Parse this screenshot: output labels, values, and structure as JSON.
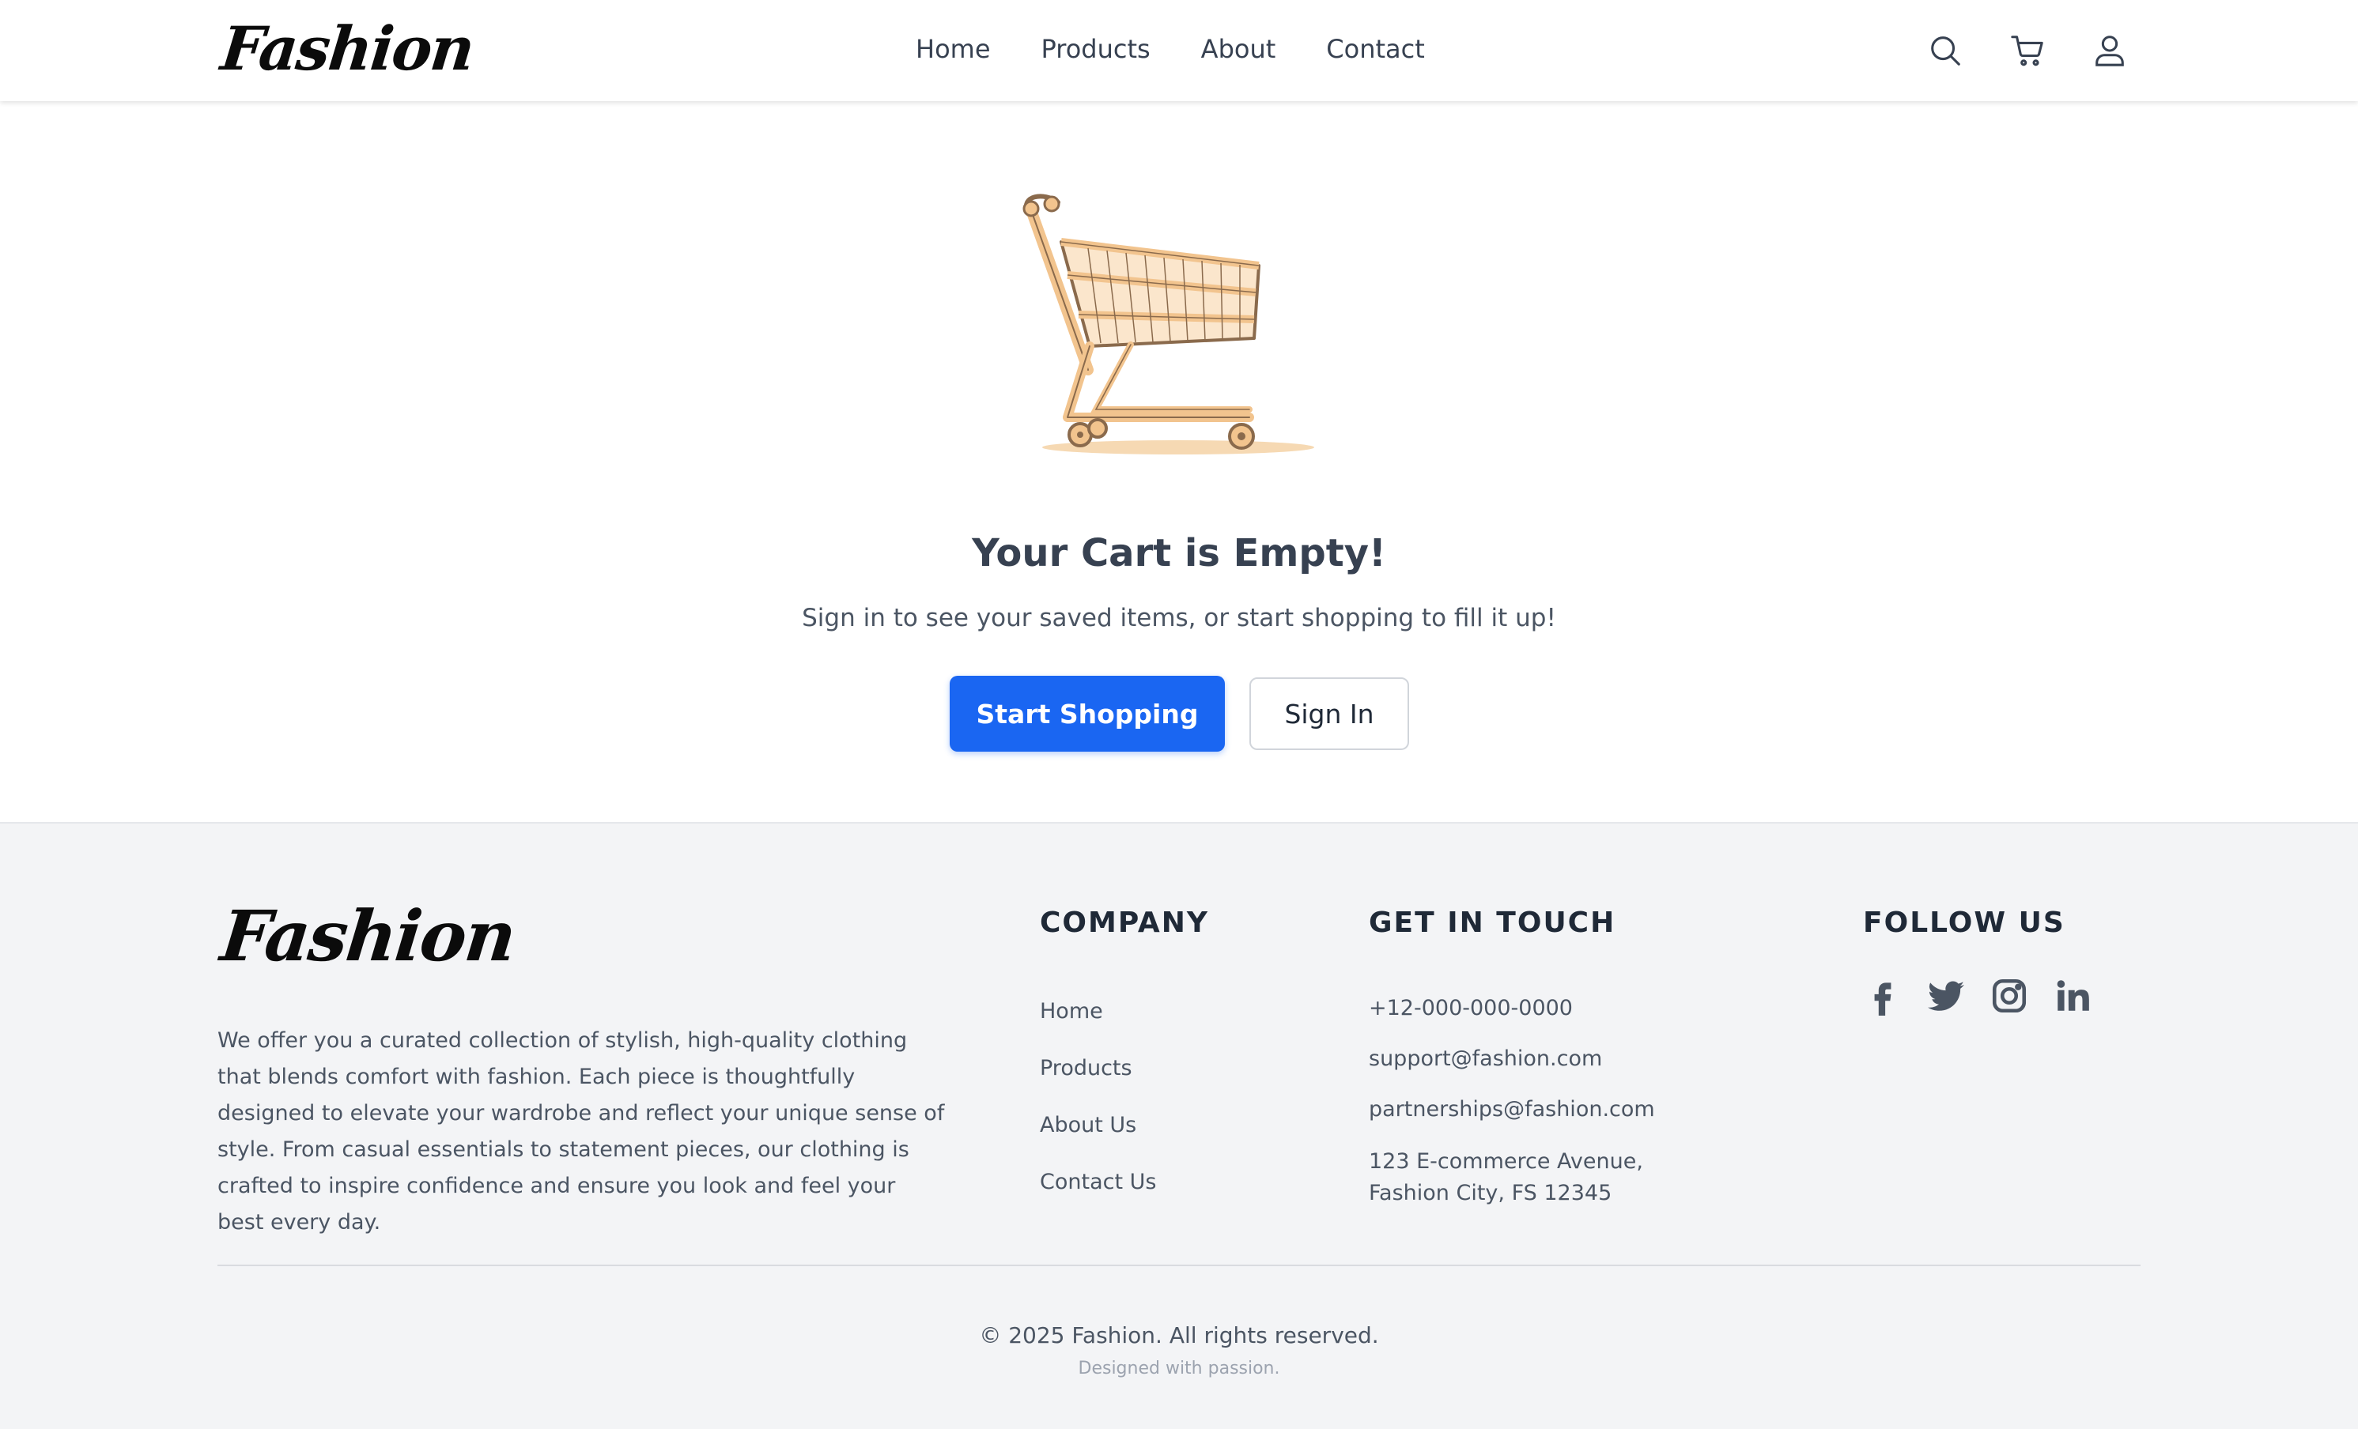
{
  "brand": {
    "name": "Fashion"
  },
  "nav": {
    "items": [
      {
        "label": "Home"
      },
      {
        "label": "Products"
      },
      {
        "label": "About"
      },
      {
        "label": "Contact"
      }
    ]
  },
  "header_icons": [
    "search-icon",
    "cart-icon",
    "user-icon"
  ],
  "empty_cart": {
    "title": "Your Cart is Empty!",
    "subtitle": "Sign in to see your saved items, or start shopping to fill it up!",
    "primary_button": "Start Shopping",
    "secondary_button": "Sign In",
    "illustration": "shopping-cart-illustration"
  },
  "footer": {
    "about": "We offer you a curated collection of stylish, high-quality clothing that blends comfort with fashion. Each piece is thoughtfully designed to elevate your wardrobe and reflect your unique sense of style. From casual essentials to statement pieces, our clothing is crafted to inspire confidence and ensure you look and feel your best every day.",
    "company": {
      "title": "COMPANY",
      "links": [
        {
          "label": "Home"
        },
        {
          "label": "Products"
        },
        {
          "label": "About Us"
        },
        {
          "label": "Contact Us"
        }
      ]
    },
    "contact": {
      "title": "GET IN TOUCH",
      "phone": "+12-000-000-0000",
      "email_support": "support@fashion.com",
      "email_partner": "partnerships@fashion.com",
      "address_line1": "123 E-commerce Avenue,",
      "address_line2": "Fashion City, FS 12345"
    },
    "follow": {
      "title": "FOLLOW US",
      "icons": [
        "facebook-icon",
        "twitter-icon",
        "instagram-icon",
        "linkedin-icon"
      ]
    },
    "copyright": "© 2025 Fashion. All rights reserved.",
    "designed": "Designed with passion."
  },
  "colors": {
    "accent": "#1a66f2",
    "text_dark": "#1f2937",
    "text_muted": "#4b5563",
    "footer_bg": "#f3f4f6",
    "cart_fill": "#f5cfa0",
    "cart_stroke": "#8a6a4c"
  }
}
